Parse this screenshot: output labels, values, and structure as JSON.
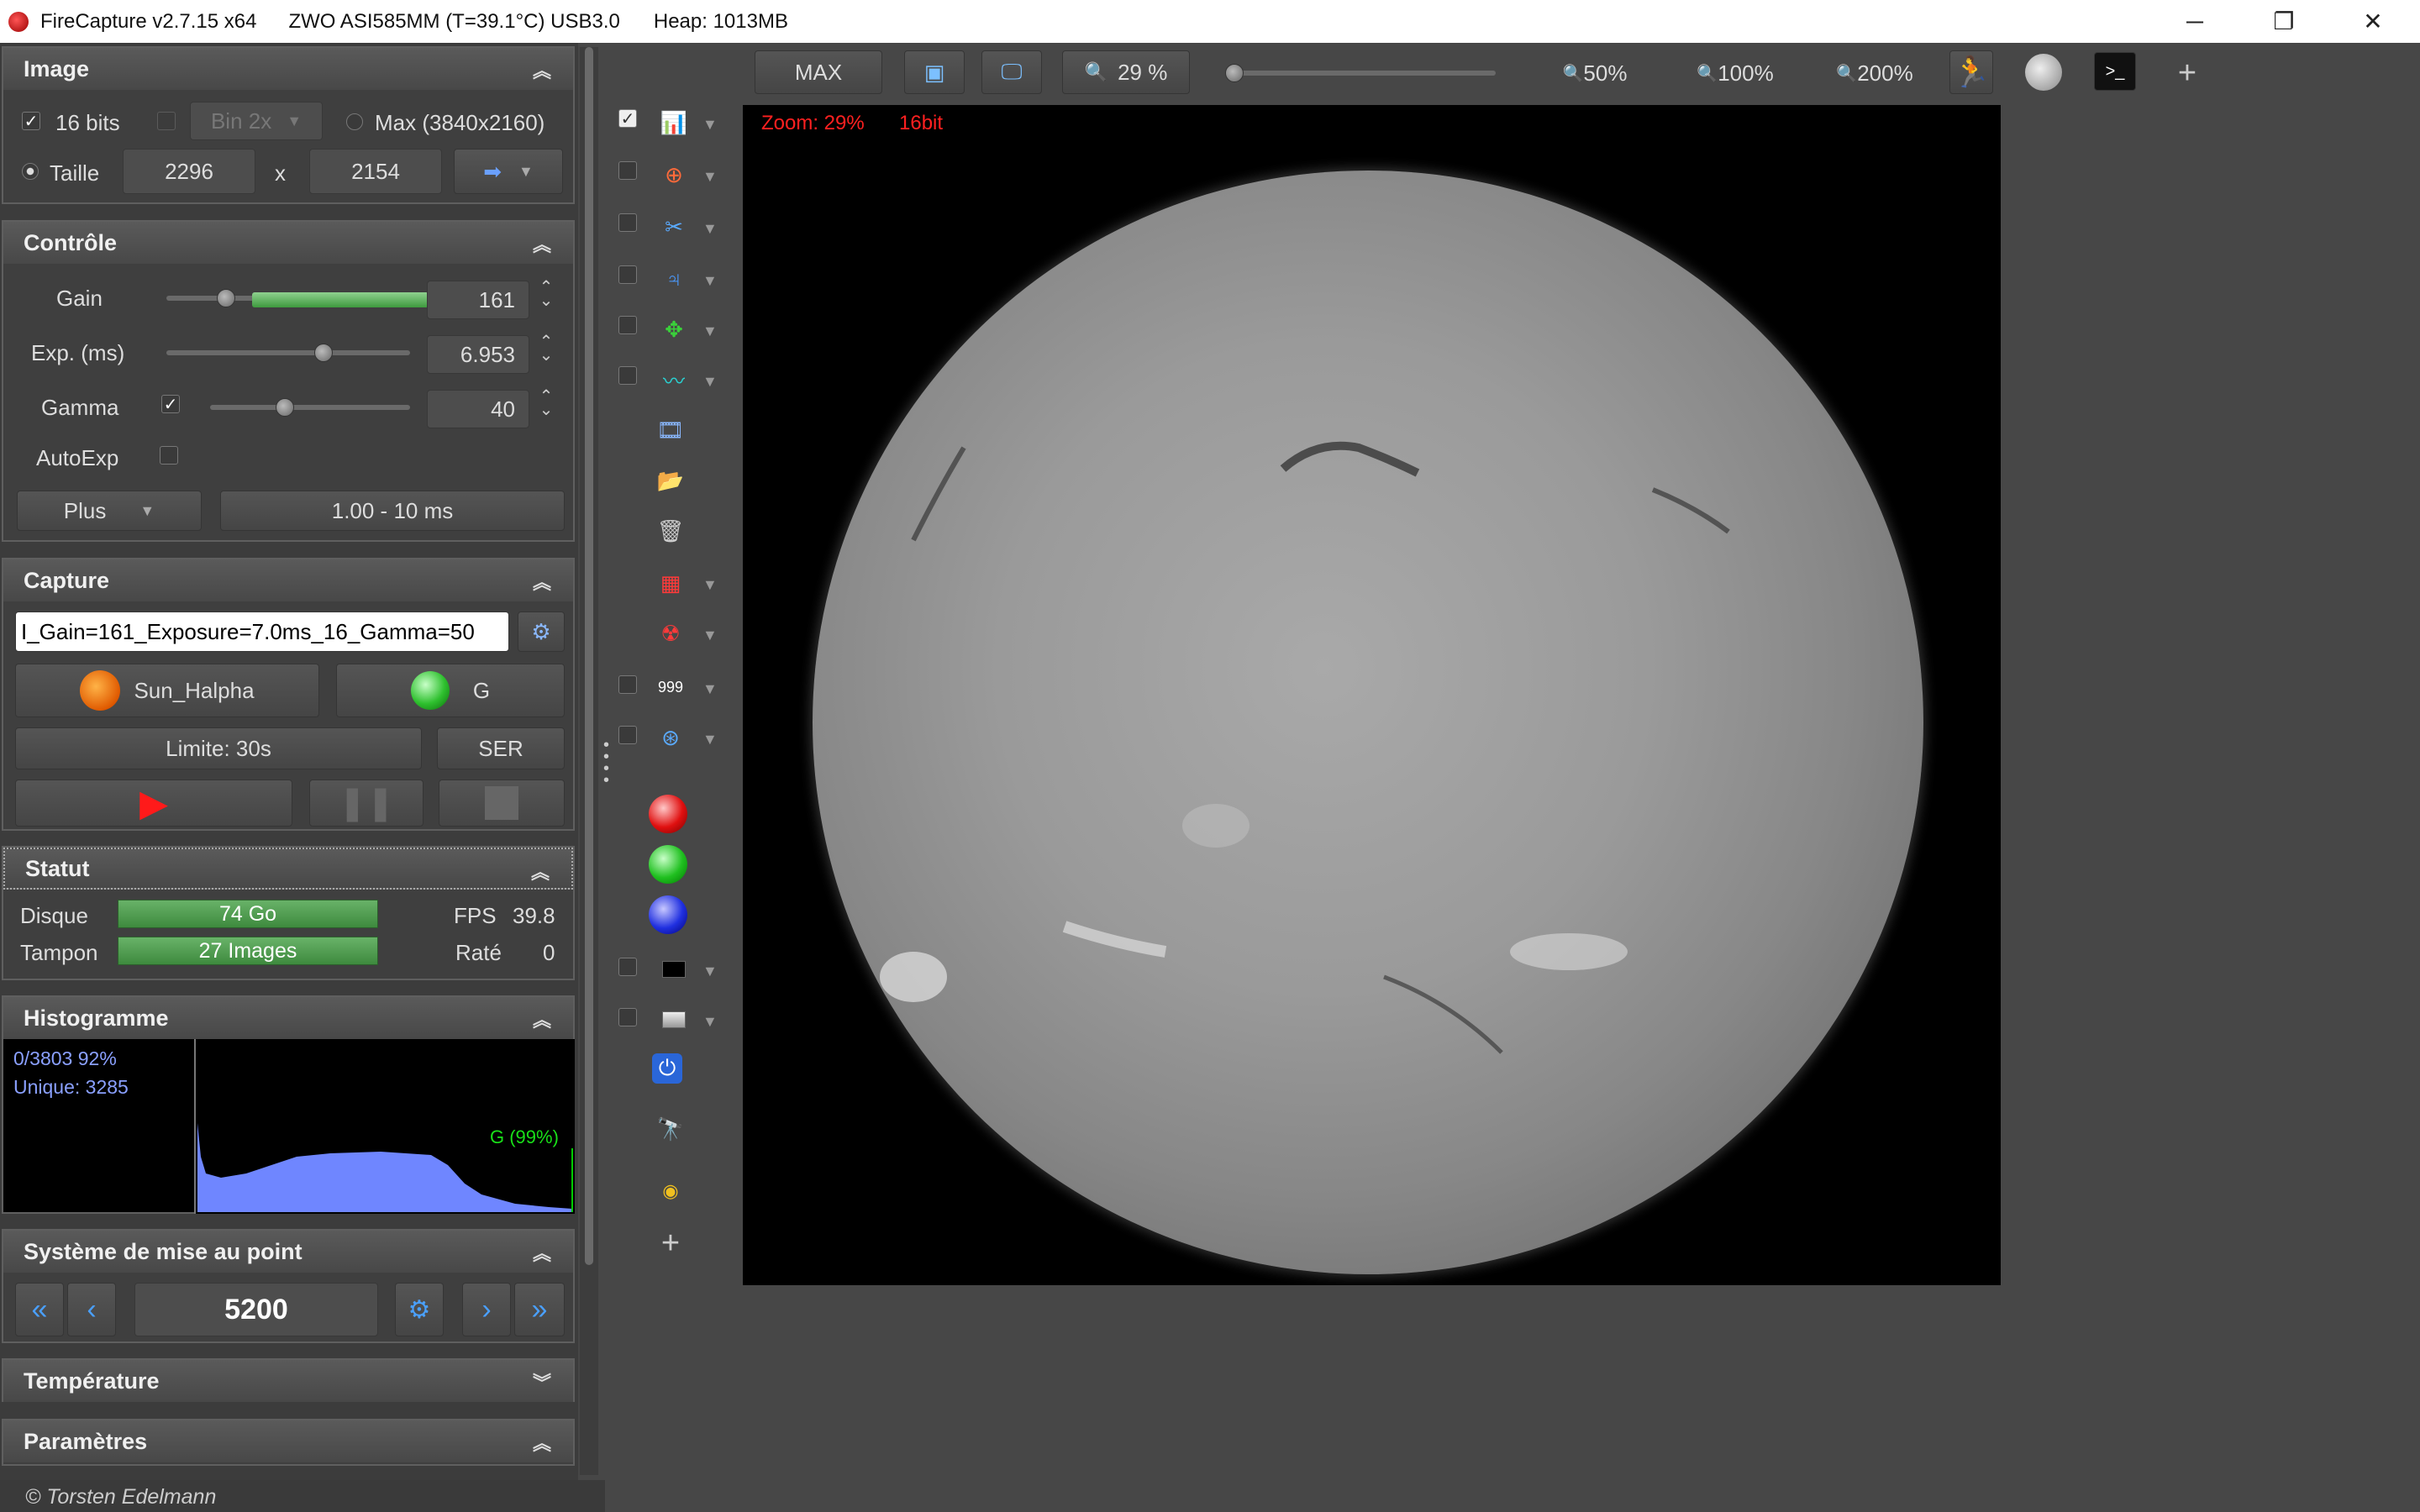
{
  "titlebar": {
    "app": "FireCapture v2.7.15 x64",
    "camera": "ZWO ASI585MM (T=39.1°C) USB3.0",
    "heap": "Heap: 1013MB"
  },
  "window_controls": {
    "minimize": "─",
    "restore": "❐",
    "close": "✕"
  },
  "image_panel": {
    "title": "Image",
    "collapse": "︽",
    "bits16": "16 bits",
    "bin": "Bin 2x",
    "max": "Max (3840x2160)",
    "taille": "Taille",
    "width": "2296",
    "x": "x",
    "height": "2154"
  },
  "controle_panel": {
    "title": "Contrôle",
    "gain_label": "Gain",
    "gain_value": "161",
    "gain_level": 0.62,
    "exp_label": "Exp. (ms)",
    "exp_value": "6.953",
    "gamma_label": "Gamma",
    "gamma_value": "40",
    "autoexp_label": "AutoExp",
    "plus": "Plus",
    "range": "1.00 - 10 ms"
  },
  "capture_panel": {
    "title": "Capture",
    "filename": "I_Gain=161_Exposure=7.0ms_16_Gamma=50",
    "profile": "Sun_Halpha",
    "filter": "G",
    "limit": "Limite: 30s",
    "format": "SER"
  },
  "statut_panel": {
    "title": "Statut",
    "disque_label": "Disque",
    "disque_value": "74 Go",
    "fps_label": "FPS",
    "fps_value": "39.8",
    "tampon_label": "Tampon",
    "tampon_value": "27 Images",
    "rate_label": "Raté",
    "rate_value": "0"
  },
  "histogramme_panel": {
    "title": "Histogramme",
    "line1": "0/3803 92%",
    "line2": "Unique: 3285",
    "channel": "G (99%)"
  },
  "focus_panel": {
    "title": "Système de mise au point",
    "position": "5200"
  },
  "temperature_panel": {
    "title": "Température"
  },
  "parametres_panel": {
    "title": "Paramètres"
  },
  "copyright": "© Torsten Edelmann",
  "toolbar": {
    "max": "MAX",
    "zoom": "29 %",
    "z50": "50%",
    "z100": "100%",
    "z200": "200%",
    "plus": "+"
  },
  "overlay": {
    "zoom": "Zoom: 29%",
    "bits": "16bit"
  },
  "colors": {
    "accent_green": "#3e8a3e",
    "histogram": "#6f86ff",
    "overlay_red": "#ff2020"
  }
}
